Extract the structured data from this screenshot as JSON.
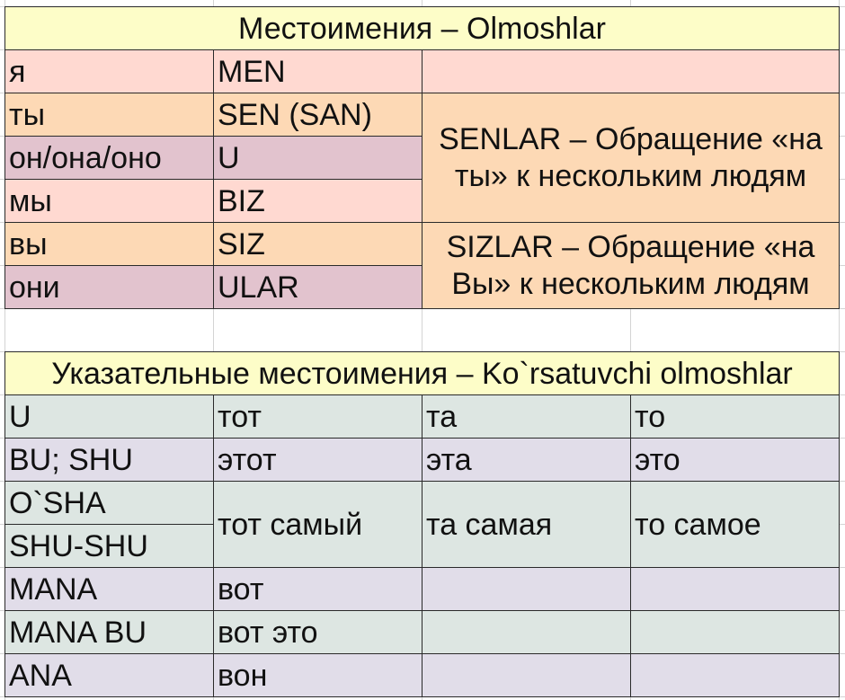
{
  "pronouns": {
    "title": "Местоимения – Olmoshlar",
    "rows": [
      {
        "ru": "я",
        "uz": "MEN"
      },
      {
        "ru": "ты",
        "uz": "SEN (SAN)"
      },
      {
        "ru": "он/она/оно",
        "uz": "U"
      },
      {
        "ru": "мы",
        "uz": "BIZ"
      },
      {
        "ru": "вы",
        "uz": "SIZ"
      },
      {
        "ru": "они",
        "uz": "ULAR"
      }
    ],
    "note_senlar": "SENLAR – Обращение «на ты» к нескольким людям",
    "note_sizlar": "SIZLAR – Обращение «на Вы» к нескольким людям"
  },
  "demonstratives": {
    "title": "Указательные местоимения – Ko`rsatuvchi olmoshlar",
    "rows": [
      {
        "uz": "U",
        "m": "тот",
        "f": "та",
        "n": "то"
      },
      {
        "uz": "BU; SHU",
        "m": "этот",
        "f": "эта",
        "n": "это"
      },
      {
        "uz": "O`SHA",
        "m": "тот самый",
        "f": "та самая",
        "n": "то самое"
      },
      {
        "uz": "SHU-SHU"
      },
      {
        "uz": "MANA",
        "m": "вот"
      },
      {
        "uz": "MANA BU",
        "m": "вот это"
      },
      {
        "uz": "ANA",
        "m": "вон"
      }
    ]
  },
  "colors": {
    "title_bg": "#fdfdc8",
    "pink": "#ffd9d1",
    "orange": "#fdd9b5",
    "mauve": "#e2c3ce",
    "green": "#dde6e2",
    "lavender": "#e1dde9"
  }
}
